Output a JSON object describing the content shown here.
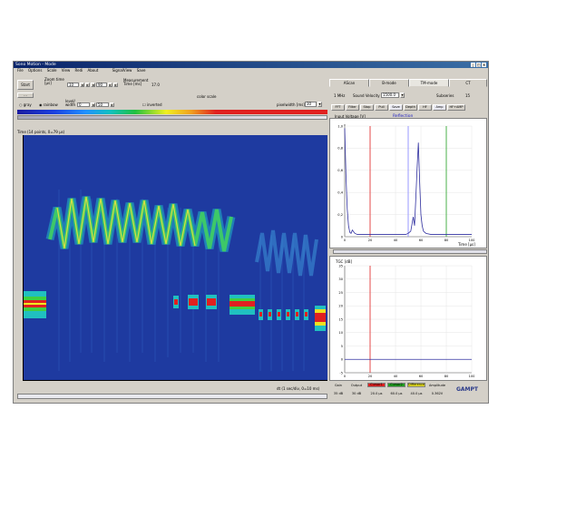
{
  "window": {
    "title": "Sono Motion - Mode",
    "menu": [
      "File",
      "Options",
      "Scale",
      "View",
      "Redi",
      "About",
      "SignalView",
      "Save"
    ]
  },
  "toolbar": {
    "start_label": "Start",
    "zoom_label": "Zoom time [µs]",
    "zoom_from": "10",
    "zoom_to": "90",
    "meas_label": "Measurement Time [ms]",
    "meas_value": "17.0",
    "color_scale_label": "color scale",
    "gray_label": "gray",
    "rainbow_label": "rainbow",
    "level_label": "level",
    "width_label": "width",
    "level_value": "0",
    "width_value": "50",
    "inverted_label": "inverted",
    "pixelwidth_label": "pixelwidth [ms]",
    "pixelwidth_value": "30",
    "small_btn": "..."
  },
  "tmode": {
    "header": "Time (14 points, 0=79 µs)",
    "footer": "dt (1 sec/div, 0=10 ms)"
  },
  "tabs": [
    "AScan",
    "B-mode",
    "TM-mode",
    "CT"
  ],
  "right_panel": {
    "probe": "1 MHz",
    "sound_velocity_label": "Sound Velocity [m/s]",
    "sound_velocity_value": "1500.0",
    "subseries_label": "Subseries",
    "subseries_value": "15",
    "buttons": [
      "FFT",
      "Filter",
      "Stop",
      "Pull",
      "Save",
      "Depth",
      "HF",
      "Amp",
      "HF+AMP"
    ],
    "active_button": "Save",
    "ascan": {
      "ylabel": "Input Voltage [V]",
      "title": "Reflection",
      "xlabel": "Time [µs]"
    },
    "tgc": {
      "ylabel": "TGC [dB]"
    }
  },
  "status": {
    "labels": [
      "Gain",
      "Output",
      "Cursor1",
      "Cursor2",
      "Difference",
      "Amplitude"
    ],
    "values": [
      "35 dB",
      "30 dB",
      "20.0 µs",
      "60.0 µs",
      "40.0 µs",
      "0.362V"
    ],
    "colors": [
      "",
      "",
      "#e02020",
      "#20a020",
      "#e8e020",
      ""
    ],
    "logo": "GAMPT"
  },
  "chart_data": [
    {
      "type": "line",
      "title": "Reflection",
      "ylabel": "Input Voltage [V]",
      "xlabel": "Time [µs]",
      "xlim": [
        0,
        100
      ],
      "ylim": [
        0,
        1.0
      ],
      "x_ticks": [
        "0",
        "20",
        "40",
        "60",
        "80",
        "100"
      ],
      "y_ticks": [
        "0",
        "0,2",
        "0,4",
        "0,6",
        "0,8",
        "1,0"
      ],
      "cursors": [
        {
          "x": 20,
          "color": "#e02020"
        },
        {
          "x": 80,
          "color": "#20a020"
        },
        {
          "x": 50,
          "color": "#8080ff"
        }
      ],
      "series": [
        {
          "x": [
            0,
            1,
            2,
            3,
            4,
            5,
            6,
            8,
            10,
            15,
            20,
            30,
            40,
            48,
            50,
            52,
            54,
            55,
            56,
            57,
            58,
            59,
            60,
            61,
            62,
            64,
            68,
            72,
            80,
            90,
            100
          ],
          "values": [
            0.98,
            0.55,
            0.25,
            0.1,
            0.04,
            0.03,
            0.06,
            0.03,
            0.02,
            0.02,
            0.02,
            0.02,
            0.02,
            0.02,
            0.03,
            0.05,
            0.18,
            0.1,
            0.35,
            0.62,
            0.85,
            0.5,
            0.2,
            0.1,
            0.05,
            0.03,
            0.02,
            0.02,
            0.02,
            0.02,
            0.02
          ]
        }
      ]
    },
    {
      "type": "line",
      "ylabel": "TGC [dB]",
      "xlim": [
        0,
        100
      ],
      "ylim": [
        -5,
        35
      ],
      "x_ticks": [
        "0",
        "20",
        "40",
        "60",
        "80",
        "100"
      ],
      "y_ticks": [
        "-5",
        "0",
        "5",
        "10",
        "15",
        "20",
        "25",
        "30",
        "35"
      ],
      "cursors": [
        {
          "x": 20,
          "color": "#e02020"
        }
      ],
      "series": [
        {
          "x": [
            0,
            100
          ],
          "values": [
            0,
            0
          ]
        }
      ]
    }
  ]
}
